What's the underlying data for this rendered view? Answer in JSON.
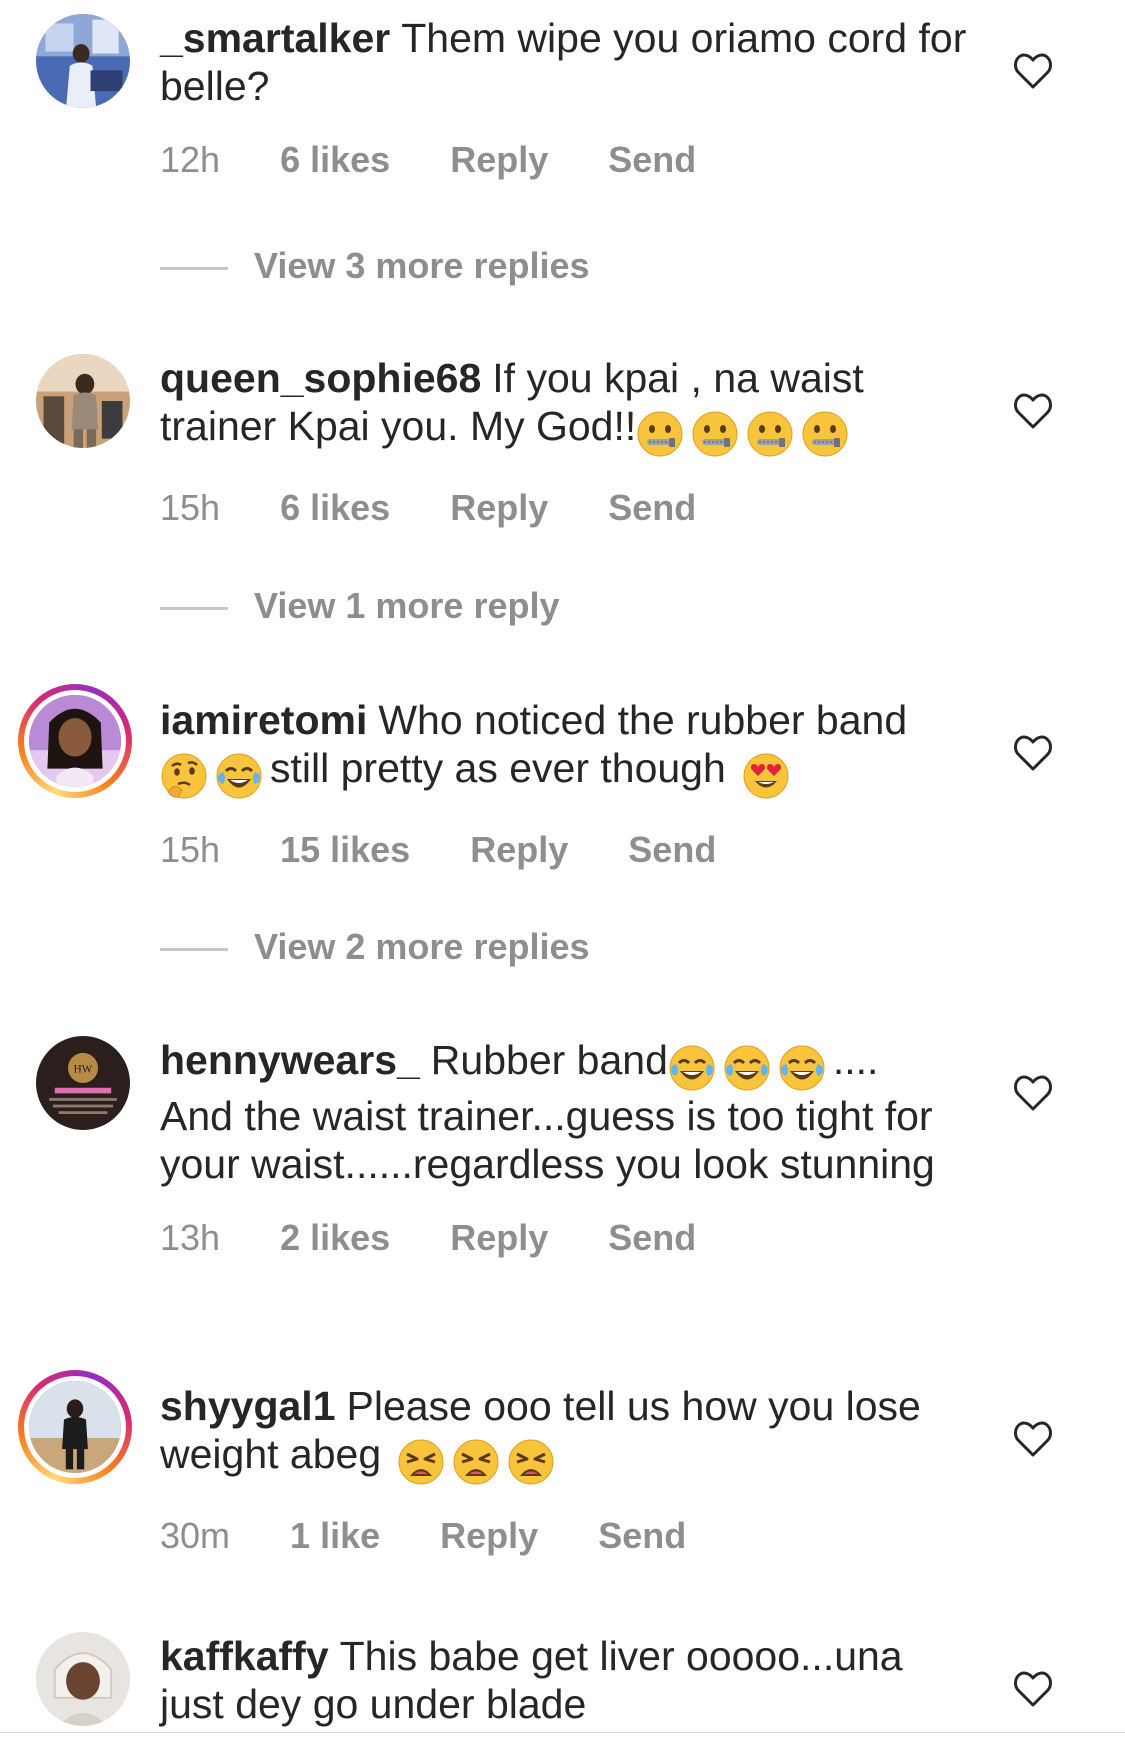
{
  "comments": [
    {
      "username": "_smartalker",
      "text": "Them wipe you oriamo cord for belle?",
      "time": "12h",
      "likes": "6 likes",
      "reply_label": "Reply",
      "send_label": "Send",
      "view_replies": "View 3 more replies",
      "story_ring": false
    },
    {
      "username": "queen_sophie68",
      "text": "If you kpai , na waist trainer Kpai you. My God!!",
      "emojis": [
        "zipper-mouth-face",
        "zipper-mouth-face",
        "zipper-mouth-face",
        "zipper-mouth-face"
      ],
      "time": "15h",
      "likes": "6 likes",
      "reply_label": "Reply",
      "send_label": "Send",
      "view_replies": "View 1 more reply",
      "story_ring": false
    },
    {
      "username": "iamiretomi",
      "text_before": "Who noticed the rubber band",
      "text_after": "still pretty as ever though",
      "emojis_mid": [
        "thinking-face",
        "tears-of-joy-face"
      ],
      "emojis_end": [
        "heart-eyes-face"
      ],
      "time": "15h",
      "likes": "15 likes",
      "reply_label": "Reply",
      "send_label": "Send",
      "view_replies": "View 2 more replies",
      "story_ring": true
    },
    {
      "username": "hennywears_",
      "text_before": "Rubber band",
      "emojis": [
        "tears-of-joy-face",
        "tears-of-joy-face",
        "tears-of-joy-face"
      ],
      "text_after": "....",
      "text_rest": "And the waist trainer...guess is too tight for your waist......regardless you look stunning",
      "time": "13h",
      "likes": "2 likes",
      "reply_label": "Reply",
      "send_label": "Send",
      "story_ring": false
    },
    {
      "username": "shyygal1",
      "text": "Please ooo tell us how you lose weight abeg",
      "emojis": [
        "weary-face",
        "weary-face",
        "weary-face"
      ],
      "time": "30m",
      "likes": "1 like",
      "reply_label": "Reply",
      "send_label": "Send",
      "story_ring": true
    },
    {
      "username": "kaffkaffy",
      "text": "This babe get liver ooooo...una just dey go under blade",
      "story_ring": false
    }
  ],
  "icons": {
    "like": "heart-outline-icon"
  },
  "colors": {
    "text": "#262626",
    "secondary": "#8e8e8e",
    "rule": "#c7c7c7"
  }
}
